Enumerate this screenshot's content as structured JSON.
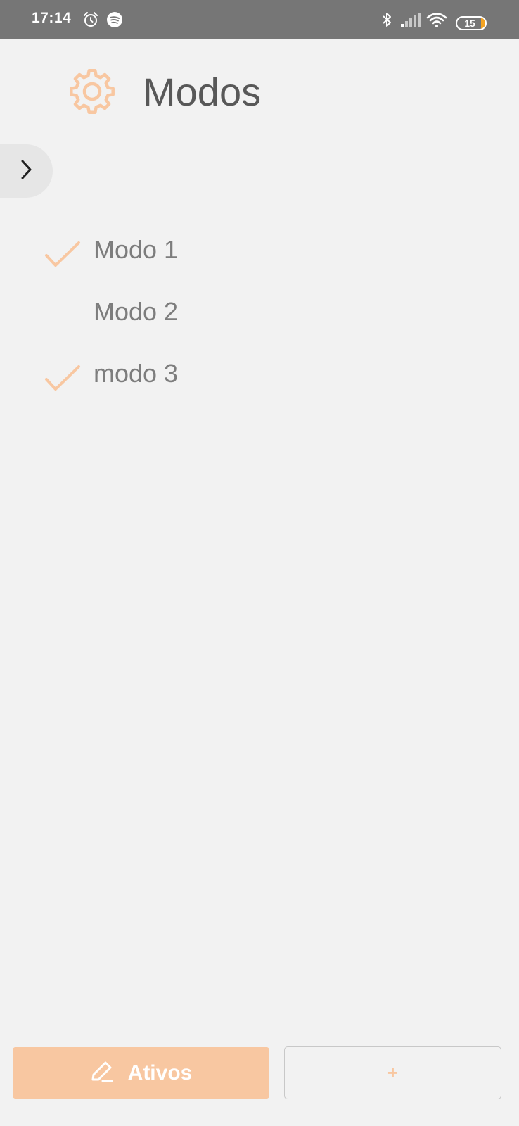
{
  "status_bar": {
    "time": "17:14",
    "battery_level": "15",
    "battery_fraction": 0.15,
    "icons": [
      "alarm-icon",
      "spotify-icon",
      "bluetooth-icon",
      "signal-icon",
      "wifi-icon",
      "battery-icon"
    ]
  },
  "header": {
    "title": "Modos",
    "icon": "gear-icon"
  },
  "drawer_toggle": {
    "icon": "chevron-right-icon"
  },
  "modes": [
    {
      "label": "Modo 1",
      "checked": true
    },
    {
      "label": "Modo 2",
      "checked": false
    },
    {
      "label": "modo 3",
      "checked": true
    }
  ],
  "footer": {
    "active_button_label": "Ativos",
    "active_button_icon": "pencil-icon",
    "add_button_label": "+"
  },
  "colors": {
    "accent": "#f8c7a1",
    "status_bar": "#767676",
    "background": "#f2f2f2",
    "title_text": "#585858",
    "item_text": "#7d7d7d"
  }
}
